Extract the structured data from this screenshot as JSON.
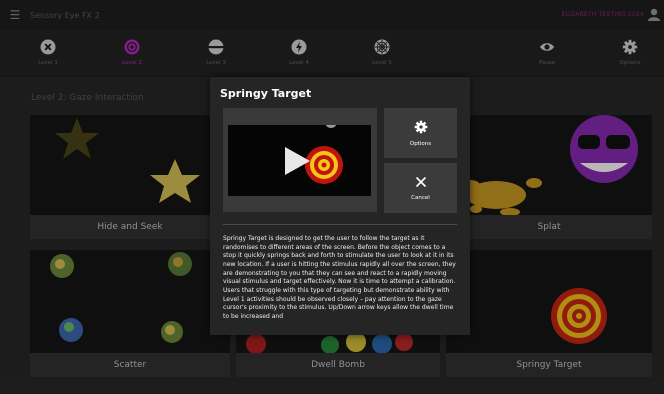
{
  "window": {
    "title": "Sensory Eye FX 2",
    "user": "ELIZABETH TESTING 2024"
  },
  "levels": [
    {
      "label": "Level 1",
      "icon": "close-circle-icon",
      "active": false
    },
    {
      "label": "Level 2",
      "icon": "target-icon",
      "active": true
    },
    {
      "label": "Level 3",
      "icon": "half-circle-icon",
      "active": false
    },
    {
      "label": "Level 4",
      "icon": "lightning-icon",
      "active": false
    },
    {
      "label": "Level 5",
      "icon": "web-icon",
      "active": false
    }
  ],
  "toolbar": {
    "pause_label": "Pause",
    "options_label": "Options"
  },
  "page": {
    "heading": "Level 2: Gaze Interaction"
  },
  "tiles": [
    {
      "caption": "Hide and Seek"
    },
    {
      "caption": "Splat"
    },
    {
      "caption": "Scatter"
    },
    {
      "caption": "Dwell Bomb"
    },
    {
      "caption": "Springy Target"
    }
  ],
  "modal": {
    "title": "Springy Target",
    "options_label": "Options",
    "cancel_label": "Cancel",
    "description": "Springy Target is designed to get the user to follow the target as it randomises to different areas of the screen. Before the object comes to a stop it quickly springs back and forth to stimulate the user to look at it in its new location. If a user is hitting the stimulus rapidly all over the screen, they are demonstrating to you that they can see and react to a rapidly moving visual stimulus and target effectively. Now it is time to attempt a calibration. Users that struggle with this type of targeting but demonstrate ability with Level 1 activities should be observed closely – pay attention to the gaze cursor's proximity to the stimulus. Up/Down arrow keys allow the dwell time to be increased and"
  },
  "colors": {
    "accent": "#c026c6",
    "background": "#282828",
    "modal": "#252525"
  }
}
